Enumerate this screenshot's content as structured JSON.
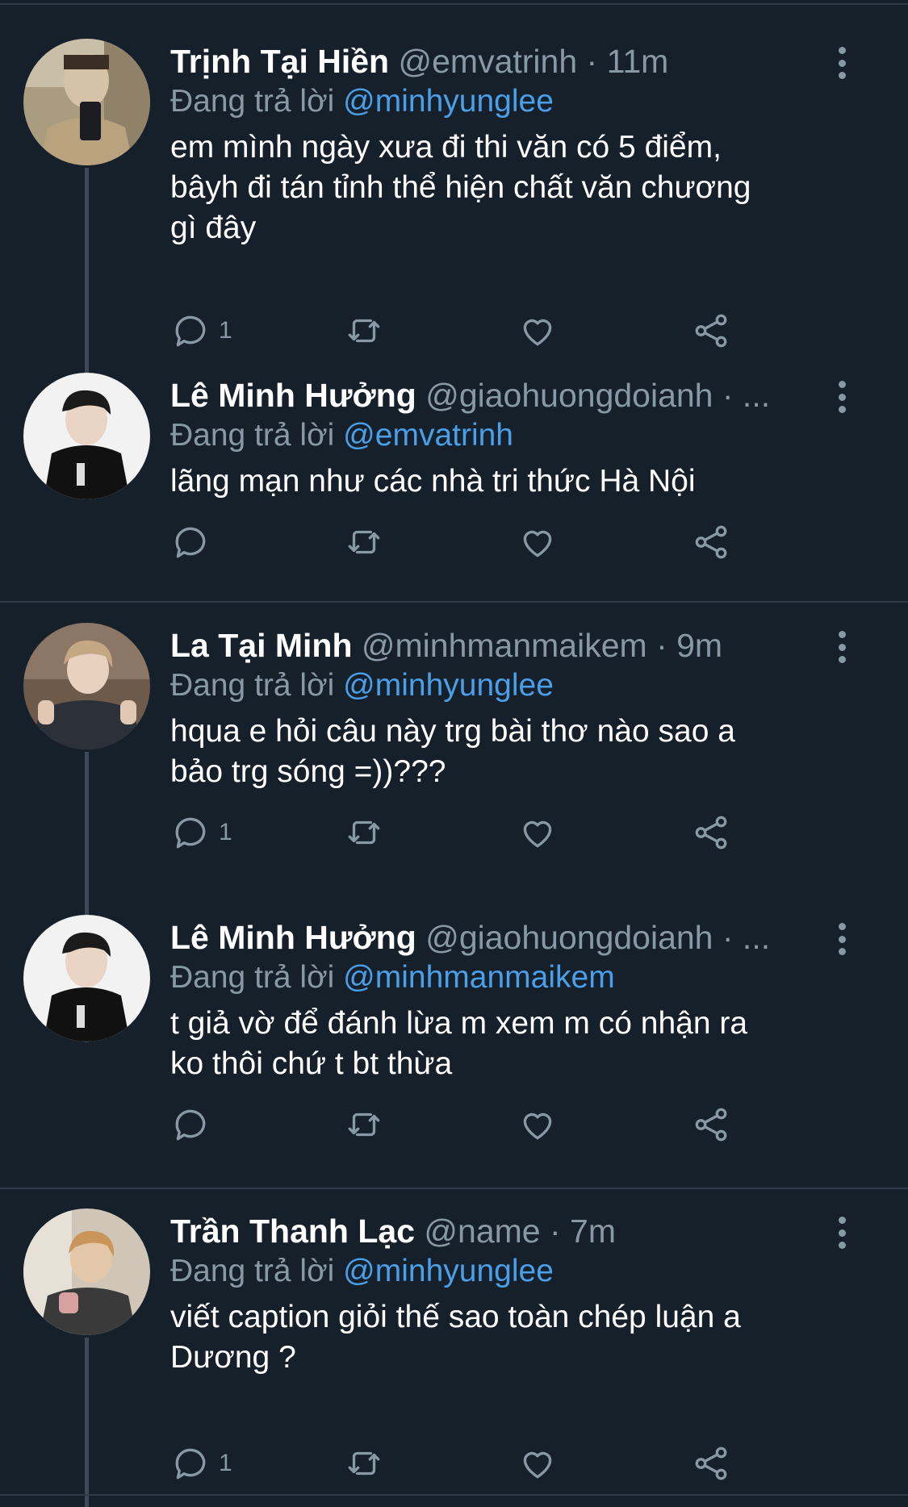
{
  "reply_prefix": "Đang trả lời",
  "tweets": [
    {
      "name": "Trịnh Tại Hiền",
      "handle": "@emvatrinh",
      "sep": " · ",
      "time": "11m",
      "reply_to": "@minhyunglee",
      "text": "em mình ngày xưa đi thi văn có 5 điểm,\nbâyh đi tán tỉnh thể hiện chất văn chương\ngì đây",
      "reply_count": "1"
    },
    {
      "name": "Lê Minh Hưởng",
      "handle": "@giaohuongdoianh",
      "sep": " · ...",
      "time": "",
      "reply_to": "@emvatrinh",
      "text": "lãng mạn như các nhà tri thức Hà Nội",
      "reply_count": ""
    },
    {
      "name": "La Tại Minh",
      "handle": "@minhmanmaikem",
      "sep": " · ",
      "time": "9m",
      "reply_to": "@minhyunglee",
      "text": "hqua e hỏi câu này trg bài thơ nào sao a\nbảo trg sóng =))???",
      "reply_count": "1"
    },
    {
      "name": "Lê Minh Hưởng",
      "handle": "@giaohuongdoianh",
      "sep": " · ...",
      "time": "",
      "reply_to": "@minhmanmaikem",
      "text": "t giả vờ để đánh lừa m xem m có nhận ra\nko thôi chứ t bt thừa",
      "reply_count": ""
    },
    {
      "name": "Trần Thanh Lạc",
      "handle": "@name",
      "sep": " · ",
      "time": "7m",
      "reply_to": "@minhyunglee",
      "text": "viết caption giỏi thế sao toàn chép luận a\nDương ?",
      "reply_count": "1"
    }
  ],
  "icons": {
    "reply": "reply-icon",
    "retweet": "retweet-icon",
    "like": "heart-icon",
    "share": "share-icon",
    "more": "more-icon"
  },
  "colors": {
    "background": "#15202b",
    "secondary_text": "#8899a6",
    "mention": "#4a9fe8",
    "divider": "#2f3b48"
  }
}
